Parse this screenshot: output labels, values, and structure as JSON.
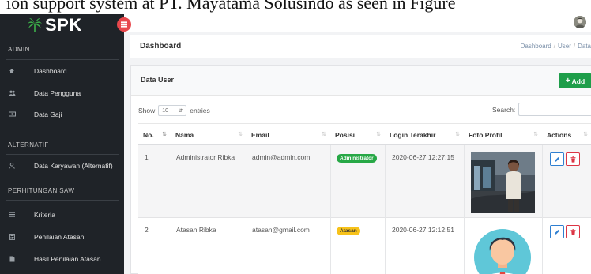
{
  "caption": "ion support system at PT. Mayatama Solusindo as seen in Figure",
  "brand": {
    "name": "SPK",
    "accent": "#e8474c",
    "sidebar_bg": "#1f2328"
  },
  "sidebar": {
    "sections": [
      {
        "title": "ADMIN",
        "items": [
          {
            "label": "Dashboard",
            "icon": "dashboard-icon"
          },
          {
            "label": "Data Pengguna",
            "icon": "users-icon"
          },
          {
            "label": "Data Gaji",
            "icon": "money-icon"
          }
        ]
      },
      {
        "title": "ALTERNATIF",
        "items": [
          {
            "label": "Data Karyawan (Alternatif)",
            "icon": "user-icon"
          }
        ]
      },
      {
        "title": "PERHITUNGAN SAW",
        "items": [
          {
            "label": "Kriteria",
            "icon": "list-icon"
          },
          {
            "label": "Penilaian Atasan",
            "icon": "calculator-icon"
          },
          {
            "label": "Hasil Penilaian Atasan",
            "icon": "file-icon"
          }
        ]
      }
    ]
  },
  "header": {
    "title": "Dashboard",
    "breadcrumb": [
      "Dashboard",
      "User",
      "Data"
    ]
  },
  "card": {
    "title": "Data User",
    "add_label": "Add",
    "add_color": "#1e9e4a",
    "show_label": "Show",
    "entries_value": "10",
    "entries_label": "entries",
    "search_label": "Search:"
  },
  "table": {
    "columns": [
      "No.",
      "Nama",
      "Email",
      "Posisi",
      "Login Terakhir",
      "Foto Profil",
      "Actions"
    ],
    "rows": [
      {
        "no": "1",
        "nama": "Administrator Ribka",
        "email": "admin@admin.com",
        "posisi": "Administrator",
        "posisi_color": "#27a846",
        "login": "2020-06-27 12:27:15",
        "photo": "photo-person"
      },
      {
        "no": "2",
        "nama": "Atasan Ribka",
        "email": "atasan@gmail.com",
        "posisi": "Atasan",
        "posisi_color": "#f7c21a",
        "login": "2020-06-27 12:12:51",
        "photo": "default-avatar"
      }
    ],
    "edit_color": "#2f7fd1",
    "delete_color": "#dc3545"
  }
}
